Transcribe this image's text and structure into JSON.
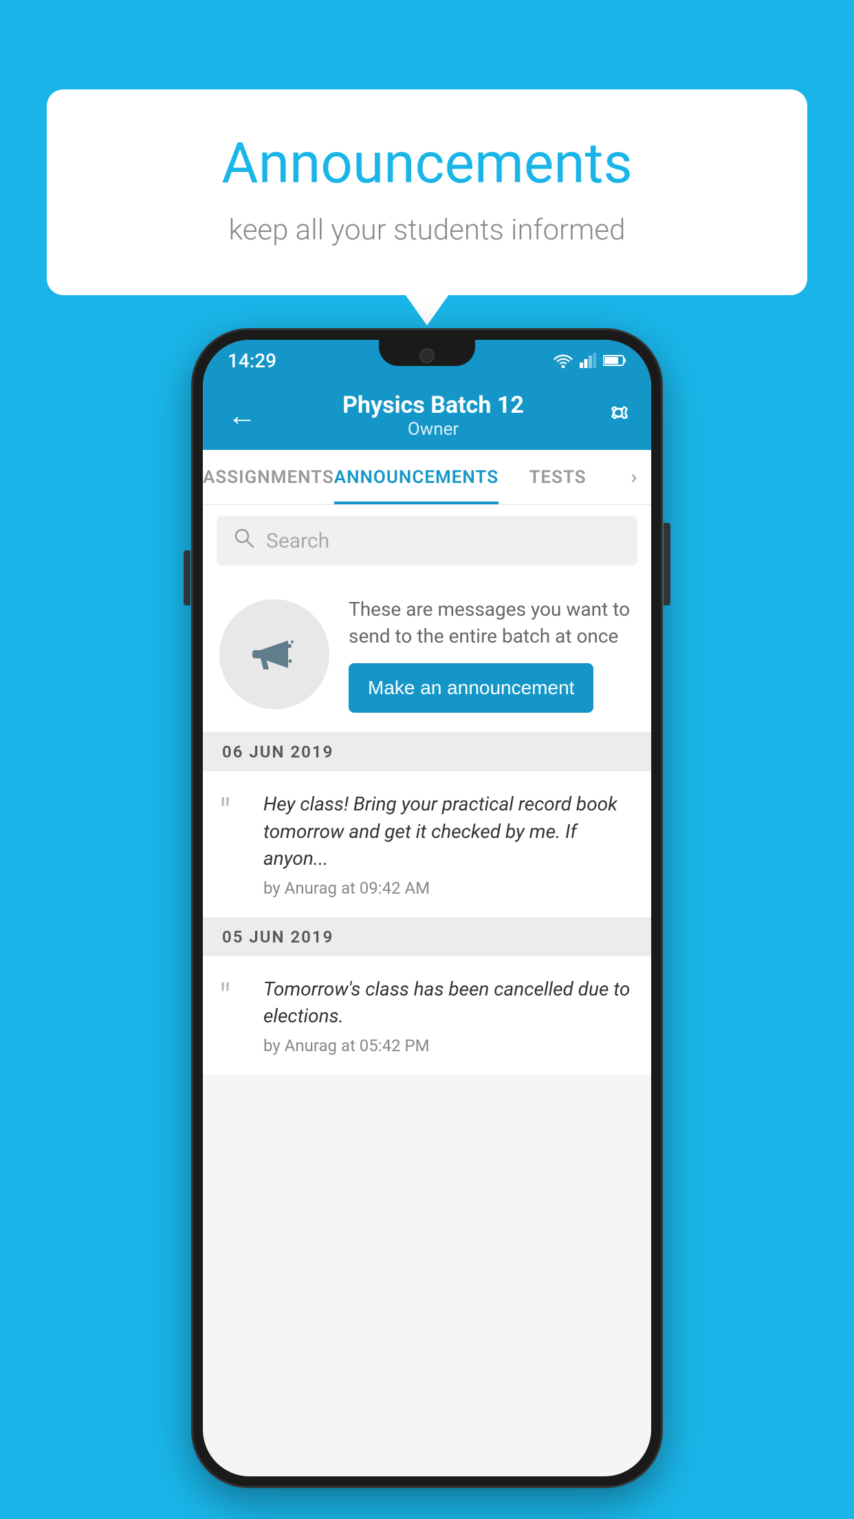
{
  "background_color": "#1ab5e8",
  "speech_bubble": {
    "title": "Announcements",
    "subtitle": "keep all your students informed"
  },
  "phone": {
    "status_bar": {
      "time": "14:29"
    },
    "app_bar": {
      "title": "Physics Batch 12",
      "subtitle": "Owner",
      "back_icon": "←",
      "settings_icon": "⚙"
    },
    "tabs": [
      {
        "label": "ASSIGNMENTS",
        "active": false
      },
      {
        "label": "ANNOUNCEMENTS",
        "active": true
      },
      {
        "label": "TESTS",
        "active": false
      }
    ],
    "search": {
      "placeholder": "Search"
    },
    "announcement_prompt": {
      "description": "These are messages you want to send to the entire batch at once",
      "button_label": "Make an announcement"
    },
    "dates": [
      {
        "date_label": "06  JUN  2019",
        "announcements": [
          {
            "message": "Hey class! Bring your practical record book tomorrow and get it checked by me. If anyon...",
            "meta": "by Anurag at 09:42 AM"
          }
        ]
      },
      {
        "date_label": "05  JUN  2019",
        "announcements": [
          {
            "message": "Tomorrow's class has been cancelled due to elections.",
            "meta": "by Anurag at 05:42 PM"
          }
        ]
      }
    ]
  }
}
